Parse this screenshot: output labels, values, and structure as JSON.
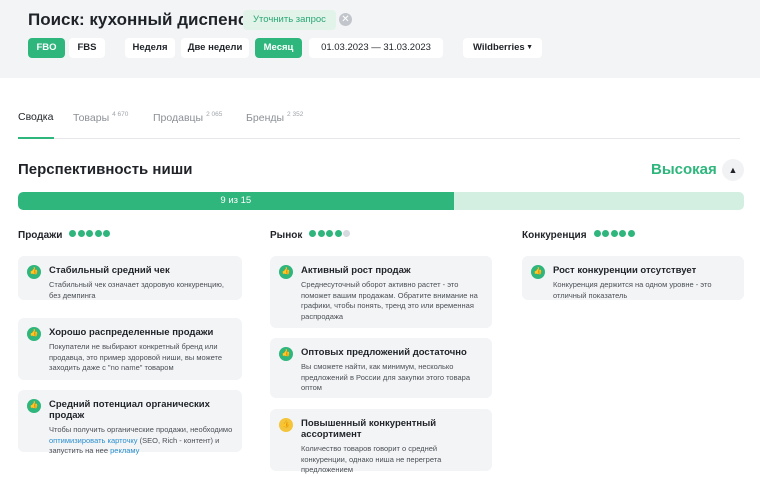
{
  "header": {
    "title": "Поиск: кухонный диспенсер",
    "refine_label": "Уточнить запрос",
    "fulfillment": [
      {
        "label": "FBO",
        "active": true
      },
      {
        "label": "FBS",
        "active": false
      }
    ],
    "periods": [
      {
        "label": "Неделя",
        "active": false
      },
      {
        "label": "Две недели",
        "active": false
      },
      {
        "label": "Месяц",
        "active": true
      }
    ],
    "date_range": "01.03.2023 — 31.03.2023",
    "marketplace": "Wildberries"
  },
  "tabs": [
    {
      "label": "Сводка",
      "count": "",
      "active": true
    },
    {
      "label": "Товары",
      "count": "4 670",
      "active": false
    },
    {
      "label": "Продавцы",
      "count": "2 065",
      "active": false
    },
    {
      "label": "Бренды",
      "count": "2 352",
      "active": false
    }
  ],
  "niche": {
    "title": "Перспективность ниши",
    "level": "Высокая",
    "score": 9,
    "max": 15,
    "score_label": "9 из 15"
  },
  "columns": [
    {
      "title": "Продажи",
      "rating": 5,
      "cards": [
        {
          "title": "Стабильный средний чек",
          "text": "Стабильный чек означает здоровую конкуренцию, без демпинга",
          "type": "good"
        },
        {
          "title": "Хорошо распределенные продажи",
          "text": "Покупатели не выбирают конкретный бренд или продавца, это пример здоровой ниши, вы можете заходить даже с \"no name\" товаром",
          "type": "good"
        },
        {
          "title": "Средний потенциал органических продаж",
          "text_before": "Чтобы получить органические продажи, необходимо",
          "link1": "оптимизировать карточку",
          "text_middle": "(SEO, Rich - контент) и запустить на нее",
          "link2": "рекламу",
          "type": "good"
        }
      ]
    },
    {
      "title": "Рынок",
      "rating": 4,
      "cards": [
        {
          "title": "Активный рост продаж",
          "text": "Среднесуточный оборот активно растет - это поможет вашим продажам. Обратите внимание на графики, чтобы понять, тренд это или временная распродажа",
          "type": "good"
        },
        {
          "title": "Оптовых предложений достаточно",
          "text": "Вы сможете найти, как минимум, несколько предложений в России для закупки этого товара оптом",
          "type": "good"
        },
        {
          "title": "Повышенный конкурентный ассортимент",
          "text": "Количество товаров говорит о средней конкуренции, однако ниша не перегрета предложением",
          "type": "warn"
        }
      ]
    },
    {
      "title": "Конкуренция",
      "rating": 5,
      "cards": [
        {
          "title": "Рост конкуренции отсутствует",
          "text": "Конкуренция держится на одном уровне - это отличный показатель",
          "type": "good"
        }
      ]
    }
  ],
  "colors": {
    "accent": "#2eb67d",
    "accent_light": "#d3efe1",
    "warn": "#f4c43b"
  },
  "icons": {
    "good": "thumbs-up-icon",
    "clear": "close-circle-icon",
    "dropdown": "chevron-down-icon",
    "collapse": "chevron-up-icon"
  }
}
